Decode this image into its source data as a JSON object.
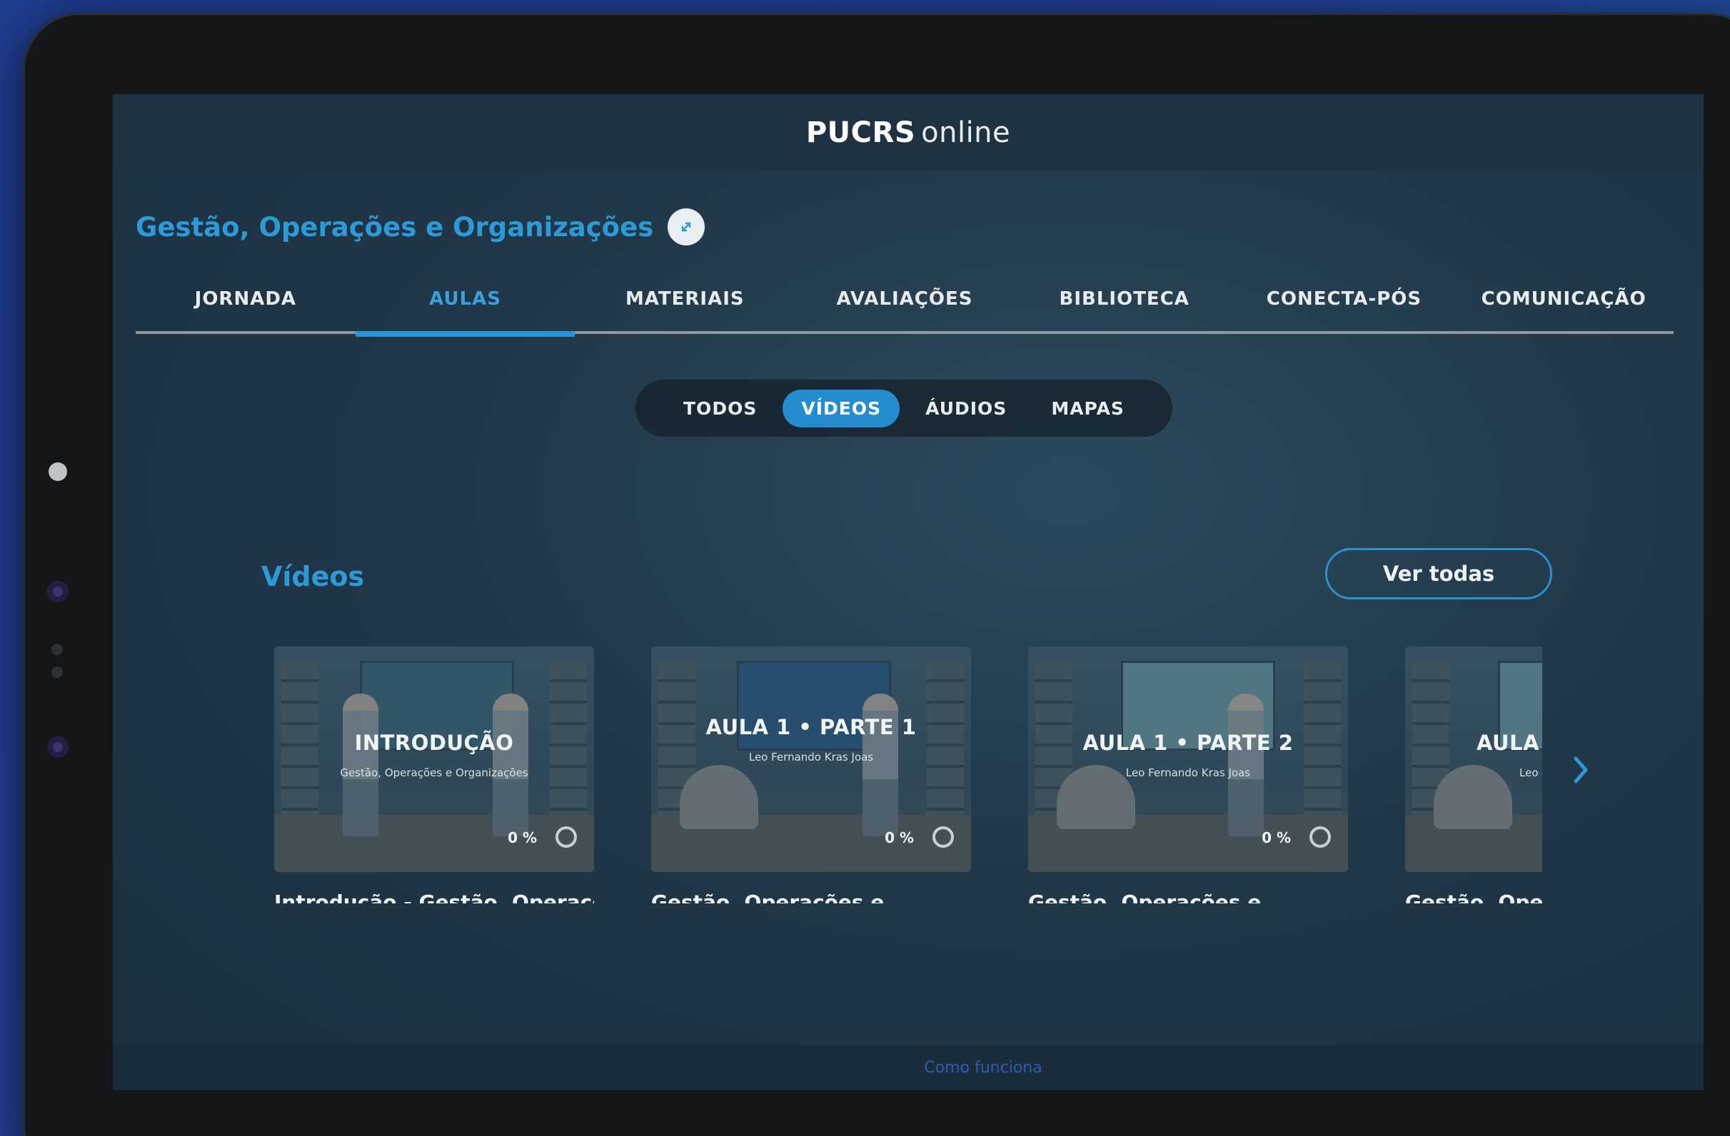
{
  "header": {
    "logo_brand": "PUCRS",
    "logo_suffix": "online"
  },
  "course": {
    "title": "Gestão, Operações e Organizações"
  },
  "tabs": [
    {
      "label": "JORNADA",
      "active": false
    },
    {
      "label": "AULAS",
      "active": true
    },
    {
      "label": "MATERIAIS",
      "active": false
    },
    {
      "label": "AVALIAÇÕES",
      "active": false
    },
    {
      "label": "BIBLIOTECA",
      "active": false
    },
    {
      "label": "CONECTA-PÓS",
      "active": false
    },
    {
      "label": "COMUNICAÇÃO",
      "active": false
    }
  ],
  "filters": [
    {
      "label": "TODOS",
      "active": false
    },
    {
      "label": "VÍDEOS",
      "active": true
    },
    {
      "label": "ÁUDIOS",
      "active": false
    },
    {
      "label": "MAPAS",
      "active": false
    }
  ],
  "section": {
    "title": "Vídeos",
    "see_all_label": "Ver todas"
  },
  "videos": [
    {
      "thumb_label": "INTRODUÇÃO",
      "thumb_sublabel": "Gestão, Operações e Organizações",
      "progress": "0 %",
      "title": "Introdução - Gestão, Operaçõ..."
    },
    {
      "thumb_label": "AULA 1 • PARTE 1",
      "thumb_sublabel": "Leo Fernando Kras Joas",
      "progress": "0 %",
      "title": "Gestão, Operações e..."
    },
    {
      "thumb_label": "AULA 1 • PARTE 2",
      "thumb_sublabel": "Leo Fernando Kras Joas",
      "progress": "0 %",
      "title": "Gestão, Operações e..."
    },
    {
      "thumb_label": "AULA",
      "thumb_sublabel": "Leo Fe",
      "progress": "",
      "title": "Gestão, Operações e..."
    }
  ],
  "footer": {
    "link": "Como funciona"
  },
  "colors": {
    "accent": "#2d9ad8",
    "active_pill": "#238dd0"
  }
}
